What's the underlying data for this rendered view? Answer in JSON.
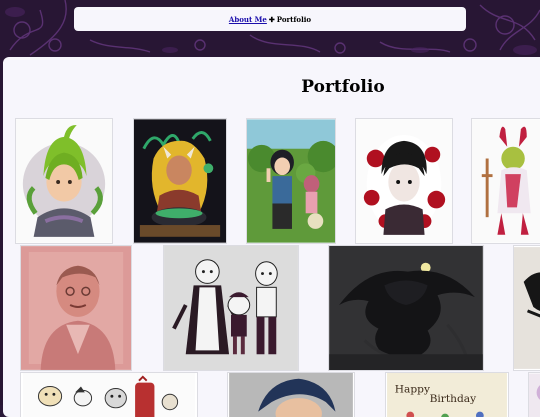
{
  "nav": {
    "about_label": "About Me",
    "separator_glyph": "✚",
    "current_label": "Portfolio"
  },
  "main": {
    "title": "Portfolio"
  },
  "gallery": {
    "birthday_text_line1": "Happy",
    "birthday_text_line2": "Birthday"
  },
  "colors": {
    "background": "#2a1838",
    "panel": "#f7f6fc",
    "link": "#1a0dab"
  }
}
